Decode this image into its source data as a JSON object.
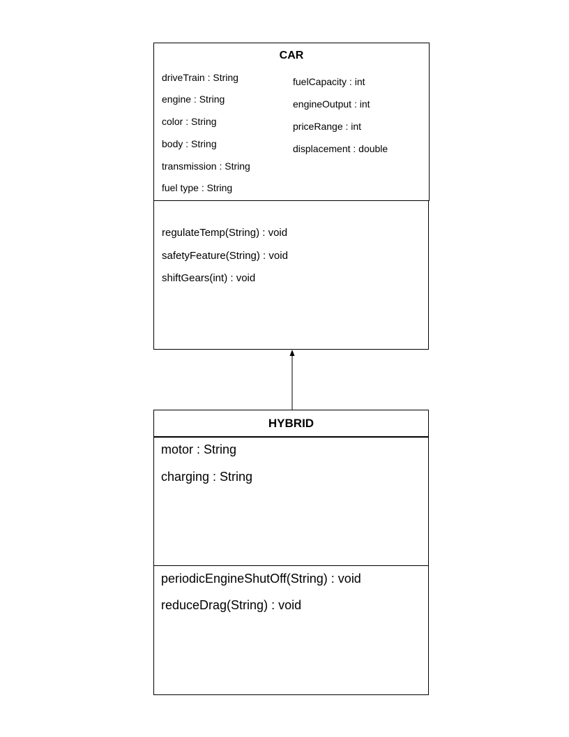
{
  "car": {
    "name": "CAR",
    "attributes_left": [
      "driveTrain : String",
      "engine : String",
      "color : String",
      "body : String",
      "transmission : String",
      "fuel type : String"
    ],
    "attributes_right": [
      "fuelCapacity : int",
      "engineOutput : int",
      "priceRange : int",
      "displacement : double"
    ],
    "operations": [
      "regulateTemp(String) : void",
      "safetyFeature(String) : void",
      "shiftGears(int) : void"
    ]
  },
  "hybrid": {
    "name": "HYBRID",
    "attributes": [
      "motor : String",
      "charging : String"
    ],
    "operations": [
      "periodicEngineShutOff(String) : void",
      "reduceDrag(String) : void"
    ]
  }
}
